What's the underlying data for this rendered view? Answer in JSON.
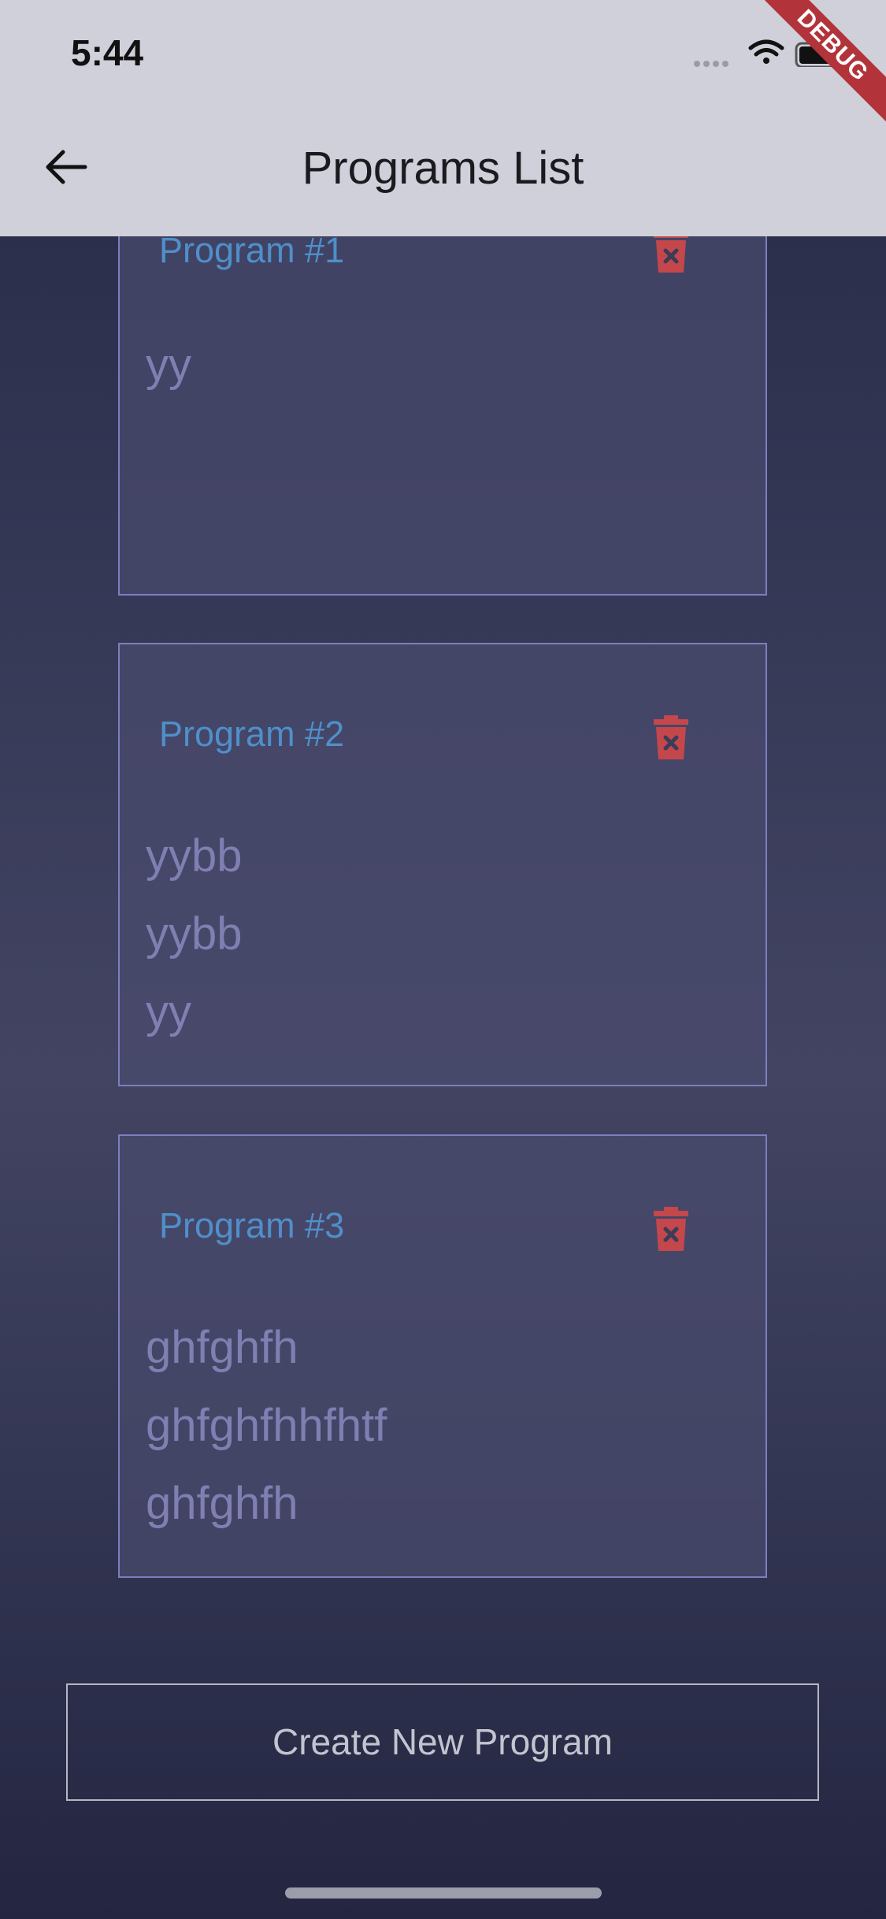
{
  "status_bar": {
    "time": "5:44",
    "icons": [
      "cellular-signal-icon",
      "wifi-icon",
      "battery-icon"
    ]
  },
  "header": {
    "title": "Programs List",
    "back_icon": "arrow-left-icon",
    "debug_banner": "DEBUG"
  },
  "programs": [
    {
      "title": "Program #1",
      "lines": [
        "yy"
      ]
    },
    {
      "title": "Program #2",
      "lines": [
        "yybb",
        "yybb",
        "yy"
      ]
    },
    {
      "title": "Program #3",
      "lines": [
        "ghfghfh",
        "ghfghfhhfhtf",
        "ghfghfh"
      ]
    }
  ],
  "delete_icon": "trash-delete-icon",
  "create_button": {
    "label": "Create New Program"
  },
  "colors": {
    "header_bg": "#cfd0da",
    "card_border": "#7c7fbf",
    "card_title": "#4f8fca",
    "card_text": "#7f7fb2",
    "delete_icon": "#c4474c",
    "debug_ribbon": "#b3333b"
  }
}
